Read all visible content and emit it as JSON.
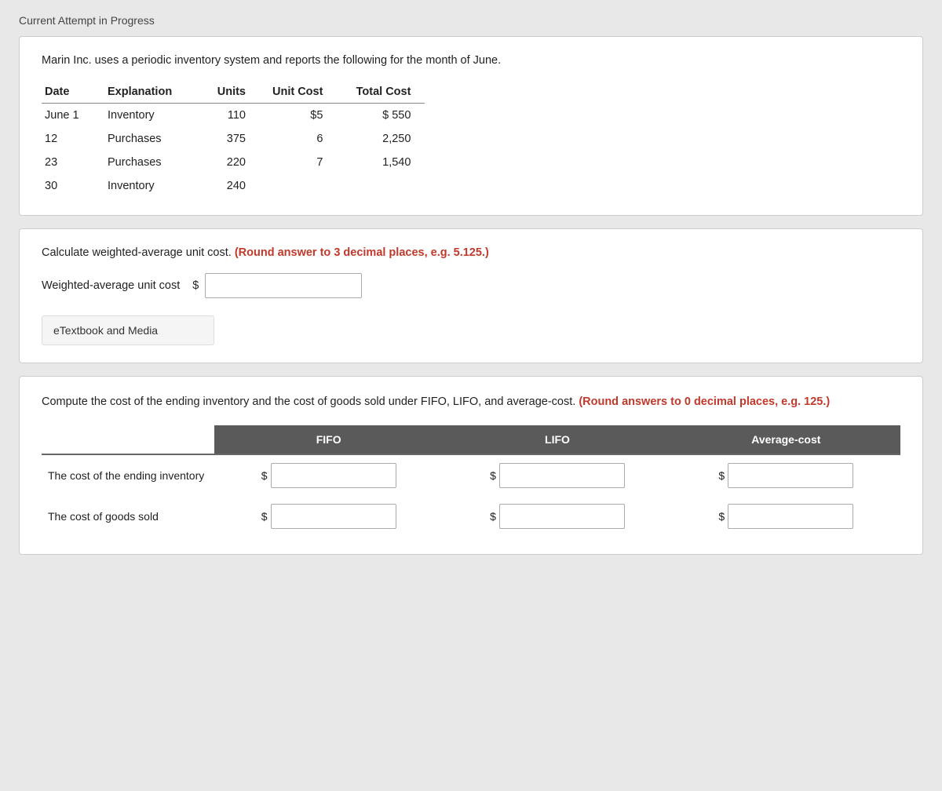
{
  "page": {
    "current_attempt_label": "Current Attempt in Progress"
  },
  "inventory_card": {
    "description": "Marin Inc. uses a periodic inventory system and reports the following for the month of June.",
    "table": {
      "headers": [
        "Date",
        "Explanation",
        "Units",
        "Unit Cost",
        "Total Cost"
      ],
      "rows": [
        {
          "date": "June 1",
          "explanation": "Inventory",
          "units": "110",
          "unit_cost": "$5",
          "total_cost": "$ 550"
        },
        {
          "date": "12",
          "explanation": "Purchases",
          "units": "375",
          "unit_cost": "6",
          "total_cost": "2,250"
        },
        {
          "date": "23",
          "explanation": "Purchases",
          "units": "220",
          "unit_cost": "7",
          "total_cost": "1,540"
        },
        {
          "date": "30",
          "explanation": "Inventory",
          "units": "240",
          "unit_cost": "",
          "total_cost": ""
        }
      ]
    }
  },
  "weighted_section": {
    "description_plain": "Calculate weighted-average unit cost. ",
    "description_bold": "(Round answer to 3 decimal places, e.g. 5.125.)",
    "input_label": "Weighted-average unit cost",
    "dollar_sign": "$",
    "etextbook_label": "eTextbook and Media"
  },
  "compute_section": {
    "description_plain": "Compute the cost of the ending inventory and the cost of goods sold under FIFO, LIFO, and average-cost. ",
    "description_bold": "(Round answers to 0 decimal places, e.g. 125.)",
    "columns": {
      "fifo": "FIFO",
      "lifo": "LIFO",
      "average_cost": "Average-cost"
    },
    "rows": [
      {
        "label": "The cost of the ending inventory",
        "dollar_fifo": "$",
        "dollar_lifo": "$",
        "dollar_avg": "$"
      },
      {
        "label": "The cost of goods sold",
        "dollar_fifo": "$",
        "dollar_lifo": "$",
        "dollar_avg": "$"
      }
    ]
  }
}
